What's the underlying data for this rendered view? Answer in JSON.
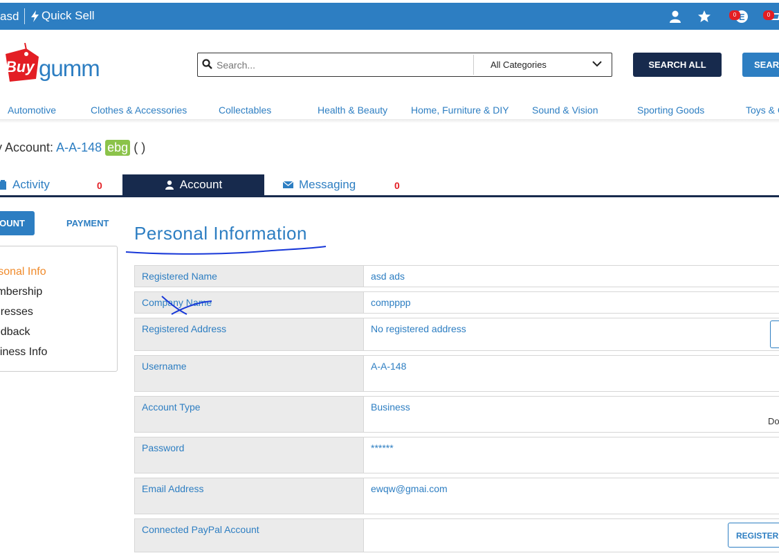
{
  "topbar": {
    "user": "asd",
    "quick_sell": "Quick Sell",
    "badge1": "0",
    "badge2": "0"
  },
  "header": {
    "logo_buy": "Buy",
    "logo_gumm": "gumm",
    "search_placeholder": "Search...",
    "category": "All Categories",
    "search_all": "SEARCH ALL",
    "search": "SEARC"
  },
  "categories": [
    "Automotive",
    "Clothes & Accessories",
    "Collectables",
    "Health & Beauty",
    "Home, Furniture & DIY",
    "Sound & Vision",
    "Sporting Goods",
    "Toys & G"
  ],
  "account": {
    "prefix": "y Account:",
    "id": "A-A-148",
    "tag": "ebg",
    "suffix": "( )"
  },
  "tabs": {
    "activity": "Activity",
    "activity_count": "0",
    "account": "Account",
    "messaging": "Messaging",
    "messaging_count": "0"
  },
  "subnav": {
    "account": "OUNT",
    "payment": "PAYMENT"
  },
  "side_menu": [
    "ersonal Info",
    "lembership",
    "ddresses",
    "eedback",
    "usiness Info"
  ],
  "section": {
    "title": "Personal Information"
  },
  "rows": [
    {
      "label": "Registered Name",
      "value": "asd ads"
    },
    {
      "label": "Company Name",
      "value": "compppp"
    },
    {
      "label": "Registered Address",
      "value": "No registered address"
    },
    {
      "label": "Username",
      "value": "A-A-148"
    },
    {
      "label": "Account Type",
      "value": "Business"
    },
    {
      "label": "Password",
      "value": "******"
    },
    {
      "label": "Email Address",
      "value": "ewqw@gmai.com"
    },
    {
      "label": "Connected PayPal Account",
      "value": ""
    }
  ],
  "register_button": "REGISTER P",
  "account_type_side": "Do"
}
